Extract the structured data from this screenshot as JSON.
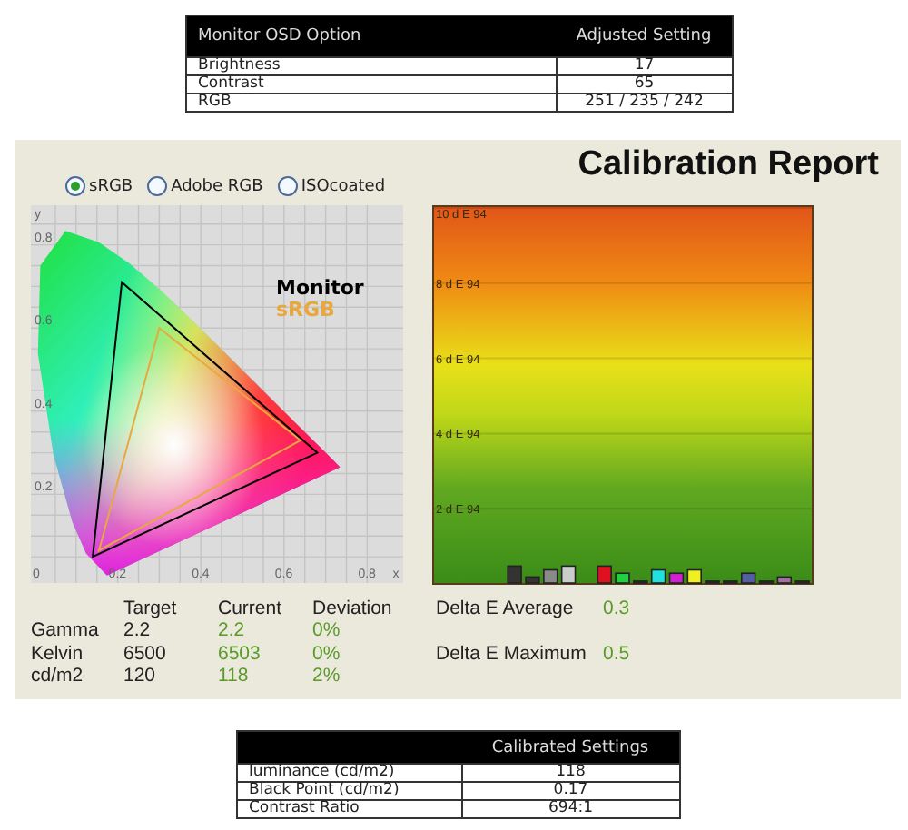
{
  "osd_table": {
    "columns": [
      "Monitor OSD Option",
      "Adjusted Setting"
    ],
    "rows": [
      [
        "Brightness",
        "17"
      ],
      [
        "Contrast",
        "65"
      ],
      [
        "RGB",
        "251 / 235 / 242"
      ]
    ]
  },
  "report": {
    "title": "Calibration Report",
    "gamut_options": [
      {
        "label": "sRGB",
        "selected": true
      },
      {
        "label": "Adobe RGB",
        "selected": false
      },
      {
        "label": "ISOcoated",
        "selected": false
      }
    ],
    "gamut_chart": {
      "x_axis": "x",
      "y_axis": "y",
      "x_ticks": [
        "0",
        "0.2",
        "0.4",
        "0.6",
        "0.8"
      ],
      "y_ticks": [
        "0.8",
        "0.6",
        "0.4",
        "0.2"
      ],
      "legend": [
        {
          "label": "Monitor",
          "color": "#000000"
        },
        {
          "label": "sRGB",
          "color": "#e8a840"
        }
      ]
    },
    "delta_e_chart": {
      "y_tick_labels": [
        "10 d E 94",
        "8 d E 94",
        "6 d E 94",
        "4 d E 94",
        "2 d E 94"
      ]
    },
    "measurements": {
      "columns": [
        "Target",
        "Current",
        "Deviation"
      ],
      "rows": [
        {
          "label": "Gamma",
          "target": "2.2",
          "current": "2.2",
          "deviation": "0%"
        },
        {
          "label": "Kelvin",
          "target": "6500",
          "current": "6503",
          "deviation": "0%"
        },
        {
          "label": "cd/m2",
          "target": "120",
          "current": "118",
          "deviation": "2%"
        }
      ]
    },
    "delta_e": [
      {
        "label": "Delta E Average",
        "value": "0.3"
      },
      {
        "label": "Delta E Maximum",
        "value": "0.5"
      }
    ]
  },
  "calibrated_table": {
    "columns": [
      "",
      "Calibrated Settings"
    ],
    "rows": [
      [
        "luminance (cd/m2)",
        "118"
      ],
      [
        "Black Point (cd/m2)",
        "0.17"
      ],
      [
        "Contrast Ratio",
        "694:1"
      ]
    ]
  }
}
